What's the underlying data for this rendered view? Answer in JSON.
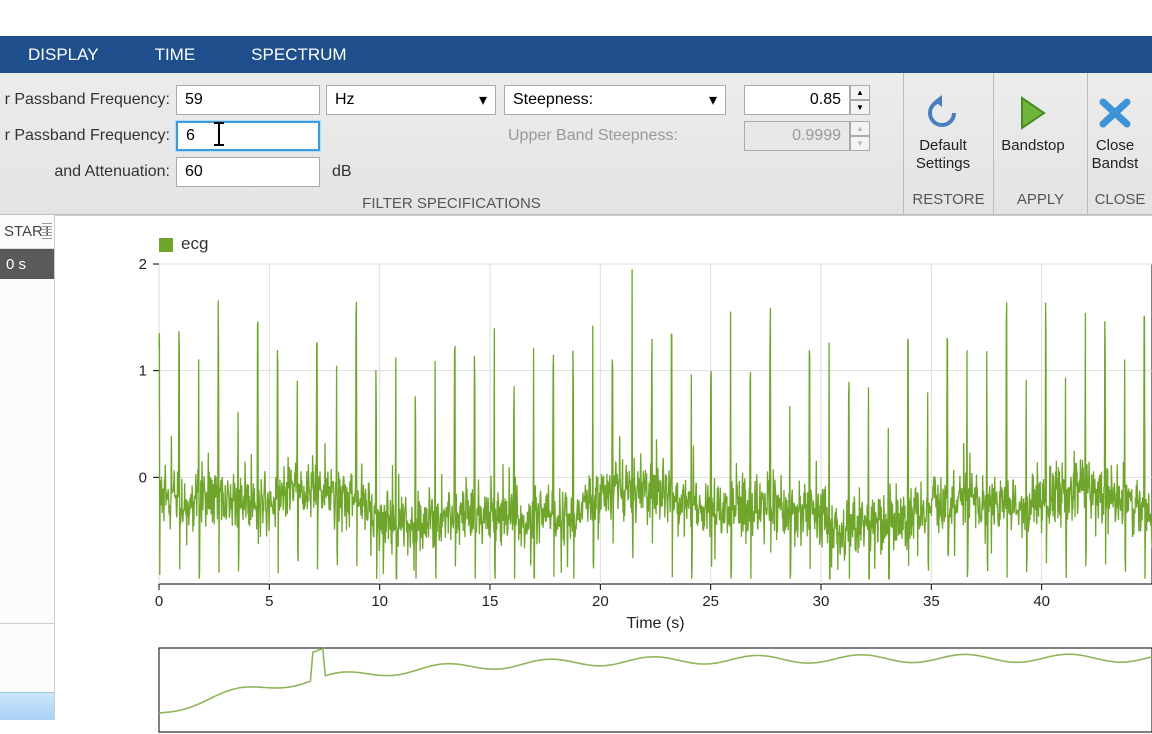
{
  "tabs": {
    "display": "DISPLAY",
    "time": "TIME",
    "spectrum": "SPECTRUM"
  },
  "filter": {
    "lower_label": "r Passband Frequency:",
    "lower_value": "59",
    "upper_label": "r Passband Frequency:",
    "upper_value": "6",
    "atten_label": "and Attenuation:",
    "atten_value": "60",
    "unit_hz": "Hz",
    "unit_db": "dB",
    "steepness_label": "Steepness:",
    "steepness_value": "0.85",
    "upper_steep_label": "Upper Band Steepness:",
    "upper_steep_value": "0.9999",
    "section_label": "FILTER SPECIFICATIONS"
  },
  "buttons": {
    "restore": {
      "line1": "Default",
      "line2": "Settings",
      "section": "RESTORE"
    },
    "apply": {
      "line1": "Bandstop",
      "section": "APPLY"
    },
    "close": {
      "line1": "Close",
      "line2": "Bandst",
      "section": "CLOSE"
    }
  },
  "sidebar": {
    "start": "START",
    "time": "0 s"
  },
  "chart_data": {
    "type": "line",
    "title": "",
    "legend": "ecg",
    "xlabel": "Time (s)",
    "ylabel": "",
    "xlim": [
      0,
      45
    ],
    "ylim": [
      -1,
      2
    ],
    "xticks": [
      0,
      5,
      10,
      15,
      20,
      25,
      30,
      35,
      40
    ],
    "yticks": [
      0,
      1,
      2
    ],
    "color": "#6fa52b",
    "series_note": "Dense noisy ECG-like waveform with periodic spikes near 1.5–2 and baseline near 0; roughly 50 spike peaks visible across 0–45 s."
  }
}
